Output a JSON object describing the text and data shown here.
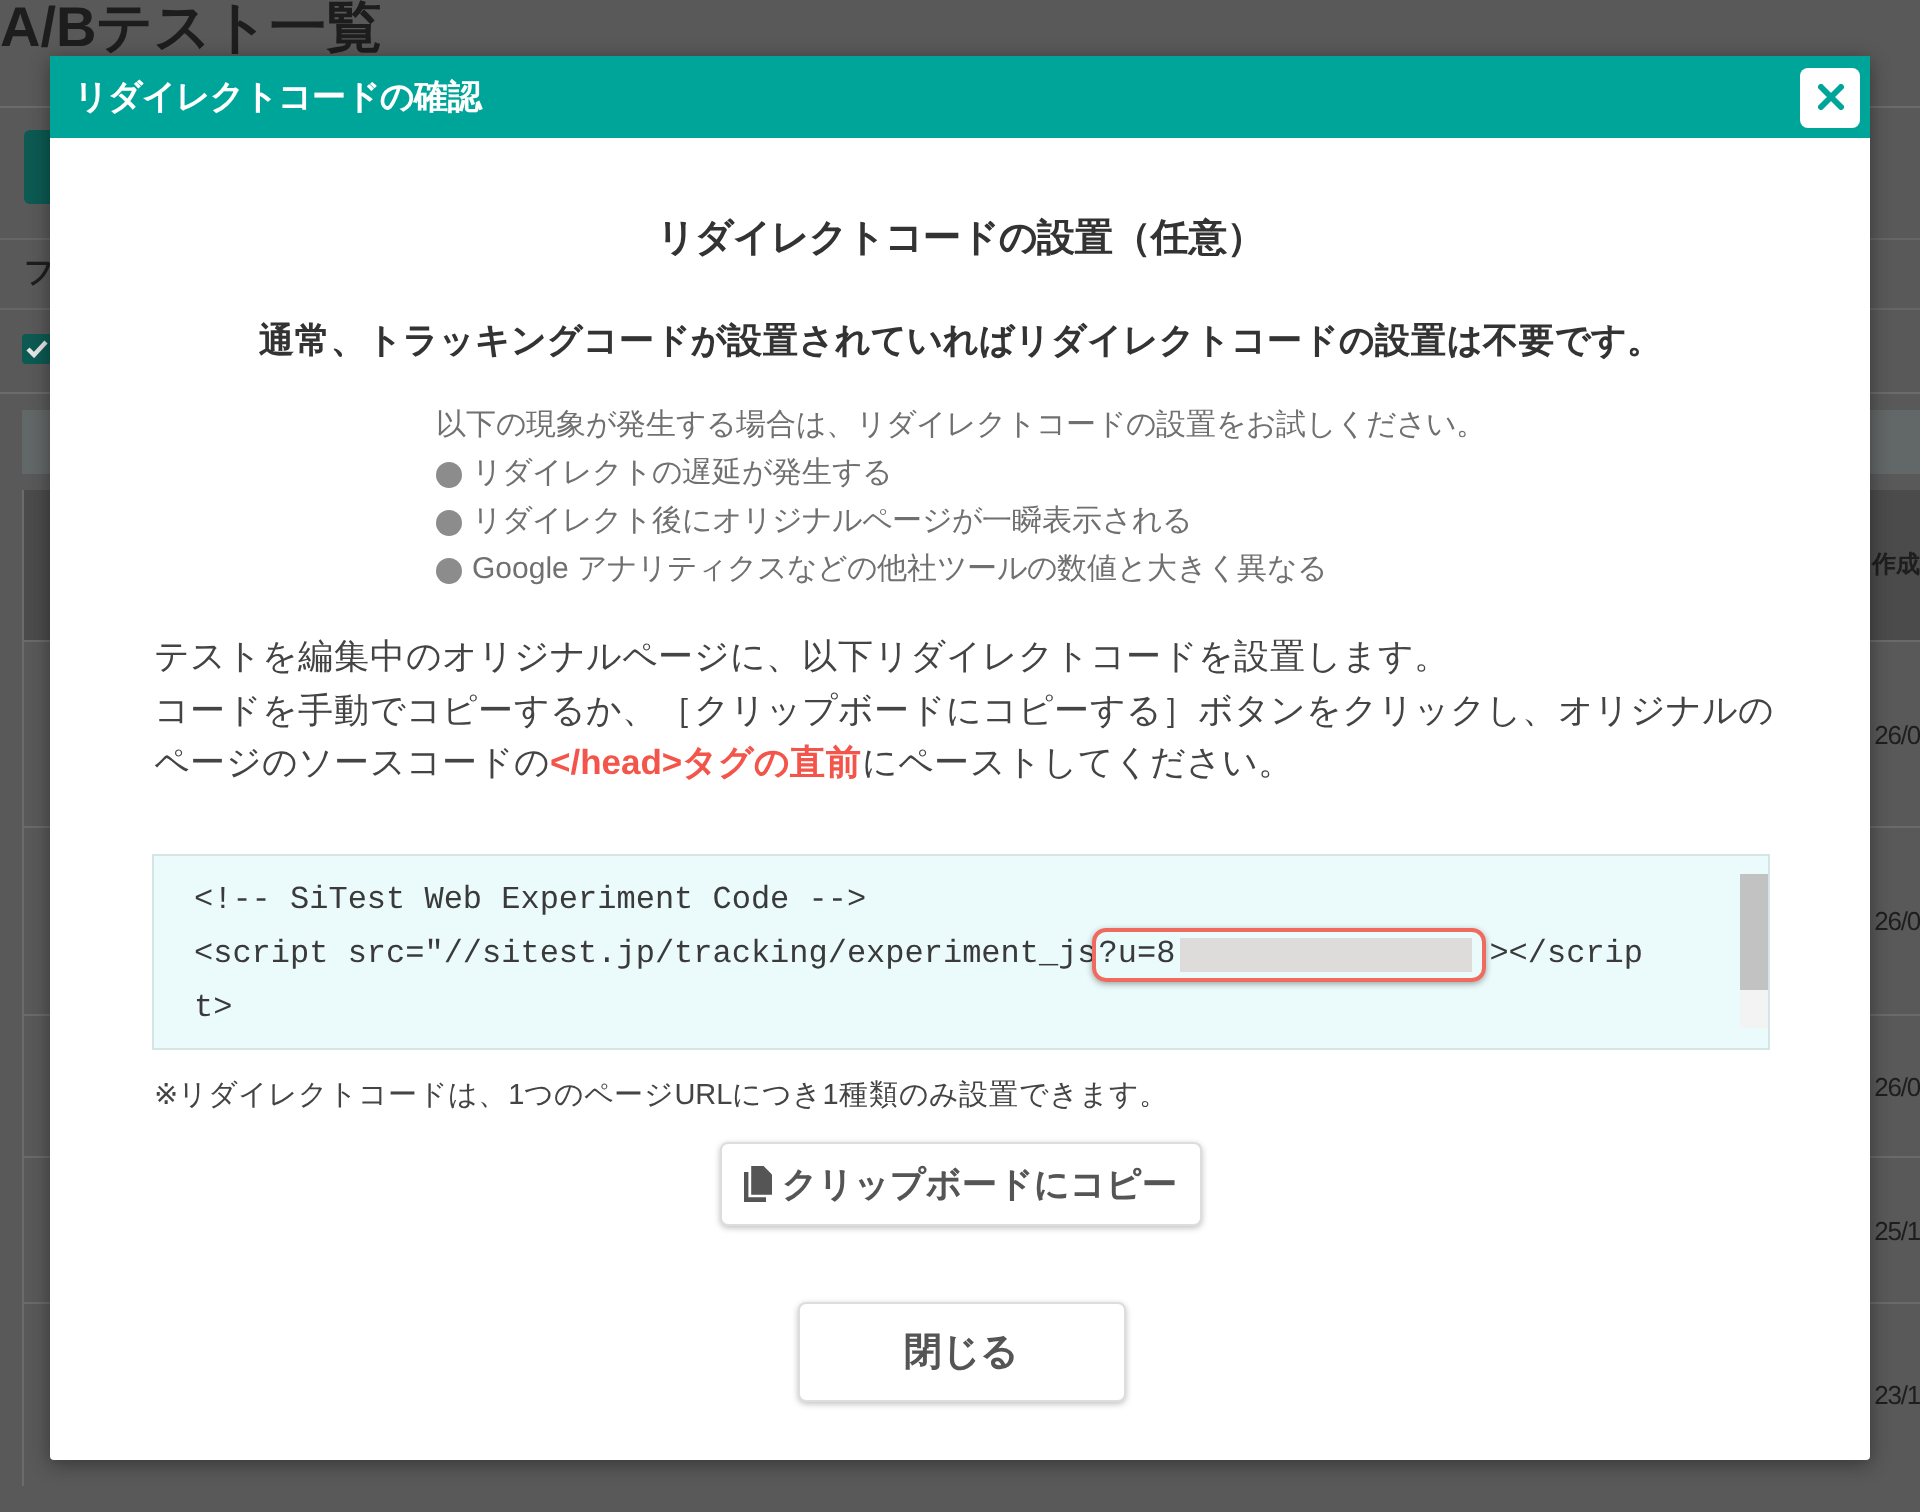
{
  "background_page": {
    "title": "A/Bテスト一覧",
    "filter_label": "フ",
    "filter_checkbox": {
      "checked": true
    },
    "table": {
      "header": "作成",
      "rows": [
        {
          "cell": "26/0"
        },
        {
          "cell": "26/0"
        },
        {
          "cell": "26/0"
        },
        {
          "cell": "25/1"
        },
        {
          "cell": "23/1"
        }
      ]
    }
  },
  "dialog": {
    "title": "リダイレクトコードの確認",
    "heading": "リダイレクトコードの設置（任意）",
    "lead": "通常、トラッキングコードが設置されていればリダイレクトコードの設置は不要です。",
    "notes": {
      "intro": "以下の現象が発生する場合は、リダイレクトコードの設置をお試しください。",
      "items": [
        "リダイレクトの遅延が発生する",
        "リダイレクト後にオリジナルページが一瞬表示される",
        "Google アナリティクスなどの他社ツールの数値と大きく異なる"
      ]
    },
    "instructions": [
      "テストを編集中のオリジナルページに、以下リダイレクトコードを設置します。",
      "コードを手動でコピーするか、［クリップボードにコピーする］ボタンをクリックし、オリジナルのページのソースコードの**</head>タグの直前**にペーストしてください。"
    ],
    "code": {
      "lines": [
        {
          "text": "<!-- SiTest Web Experiment Code -->"
        },
        {
          "text": "<script src=\"//sitest.jp/tracking/experiment_js",
          "highlight": "?u=8",
          "redacted": true,
          "after": "></scrip"
        },
        {
          "text": "t>"
        }
      ]
    },
    "caution": "※リダイレクトコードは、1つのページURLにつき1種類のみ設置できます。",
    "buttons": [
      {
        "kind": "copy",
        "label": "クリップボードにコピー"
      },
      {
        "kind": "close",
        "label": "閉じる"
      }
    ]
  }
}
